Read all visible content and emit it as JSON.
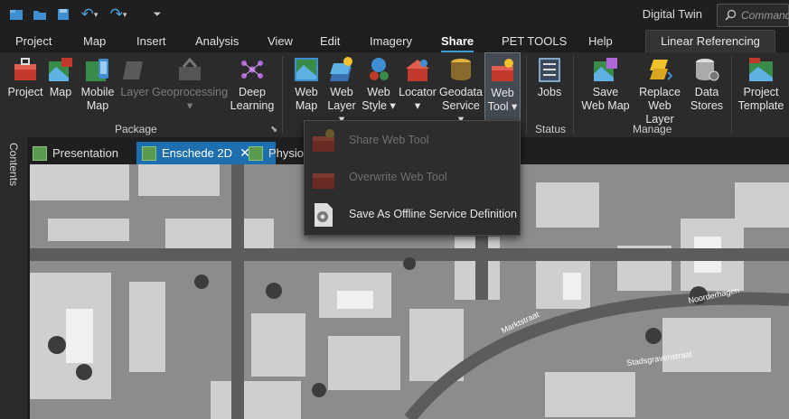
{
  "app_title": "Digital Twin",
  "command_search": {
    "placeholder": "Command"
  },
  "ribbon_tabs": [
    "Project",
    "Map",
    "Insert",
    "Analysis",
    "View",
    "Edit",
    "Imagery",
    "Share",
    "PET TOOLS",
    "Help"
  ],
  "active_tab": "Share",
  "extra_tab": "Linear Referencing",
  "ribbon": {
    "package": {
      "label": "Package",
      "buttons": [
        {
          "l1": "Project",
          "l2": ""
        },
        {
          "l1": "Map",
          "l2": ""
        },
        {
          "l1": "Mobile",
          "l2": "Map"
        },
        {
          "l1": "Layer",
          "l2": ""
        },
        {
          "l1": "Geoprocessing",
          "l2": "▾"
        },
        {
          "l1": "Deep",
          "l2": "Learning"
        }
      ]
    },
    "share_as": {
      "buttons": [
        {
          "l1": "Web",
          "l2": "Map"
        },
        {
          "l1": "Web",
          "l2": "Layer ▾"
        },
        {
          "l1": "Web",
          "l2": "Style ▾"
        },
        {
          "l1": "Locator",
          "l2": "▾"
        },
        {
          "l1": "Geodata",
          "l2": "Service ▾"
        },
        {
          "l1": "Web",
          "l2": "Tool ▾"
        }
      ]
    },
    "status": {
      "label": "Status",
      "buttons": [
        {
          "l1": "Jobs",
          "l2": ""
        }
      ]
    },
    "manage": {
      "label": "Manage",
      "buttons": [
        {
          "l1": "Save",
          "l2": "Web Map"
        },
        {
          "l1": "Replace",
          "l2": "Web Layer"
        },
        {
          "l1": "Data",
          "l2": "Stores"
        }
      ]
    },
    "template": {
      "buttons": [
        {
          "l1": "Project",
          "l2": "Template"
        }
      ]
    }
  },
  "doc_tabs": [
    {
      "label": "Presentation"
    },
    {
      "label": "Enschede 2D"
    },
    {
      "label": "Physiol"
    }
  ],
  "side_panel": "Contents",
  "web_tool_menu": [
    {
      "label": "Share Web Tool",
      "enabled": false
    },
    {
      "label": "Overwrite Web Tool",
      "enabled": false
    },
    {
      "label": "Save As Offline Service Definition",
      "enabled": true
    }
  ],
  "map_labels": [
    "Noorderhagen",
    "Marktstraat",
    "Stadsgravenstraat"
  ],
  "colors": {
    "accent": "#3e9bd6",
    "active_doc_tab": "#1e6fb0"
  }
}
